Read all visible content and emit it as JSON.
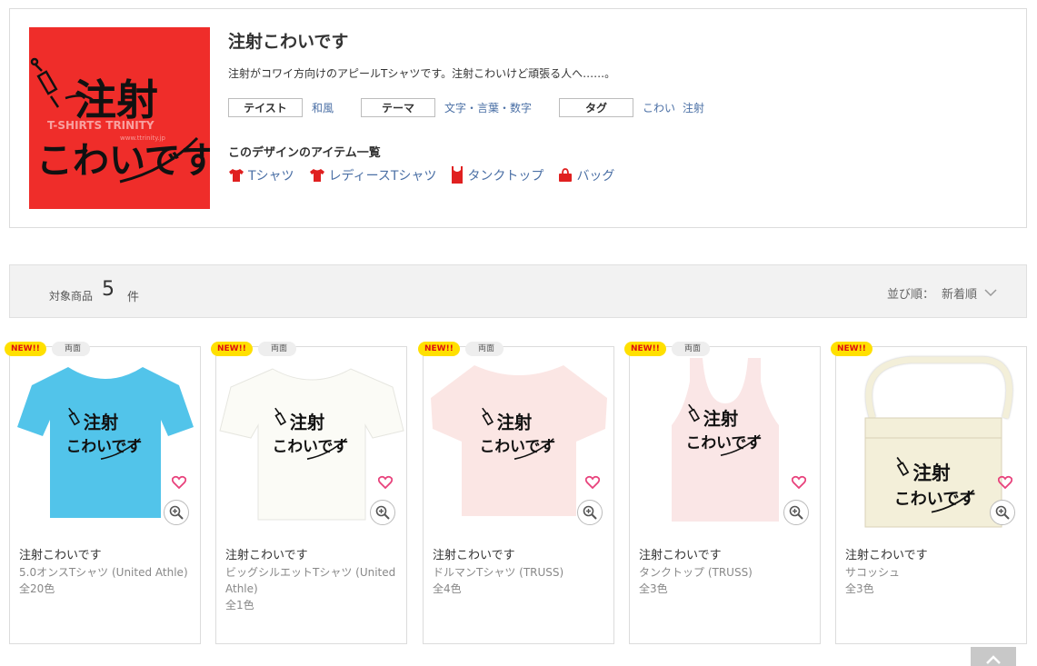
{
  "design": {
    "title": "注射こわいです",
    "description": "注射がコワイ方向けのアピールTシャツです。注射こわいけど頑張る人へ……。",
    "image_text_line1": "注射",
    "image_text_line2": "こわいです",
    "watermark": "T-SHIRTS TRINITY",
    "watermark_url": "www.ttrinity.jp",
    "image_bg_color": "#ef2d2a",
    "meta": [
      {
        "label": "テイスト",
        "links": [
          "和風"
        ]
      },
      {
        "label": "テーマ",
        "links": [
          "文字・言葉・数字"
        ]
      },
      {
        "label": "タグ",
        "links": [
          "こわい",
          "注射"
        ]
      }
    ],
    "item_list_heading": "このデザインのアイテム一覧",
    "items": [
      {
        "label": "Tシャツ",
        "icon": "tshirt-icon"
      },
      {
        "label": "レディースTシャツ",
        "icon": "ladies-tshirt-icon"
      },
      {
        "label": "タンクトップ",
        "icon": "tanktop-icon"
      },
      {
        "label": "バッグ",
        "icon": "bag-icon"
      }
    ]
  },
  "results": {
    "label": "対象商品",
    "count": "5",
    "unit": "件",
    "sort_label": "並び順：",
    "sort_value": "新着順"
  },
  "products": [
    {
      "badge_new": "NEW!!",
      "badge_side": "両面",
      "title": "注射こわいです",
      "type": "5.0オンスTシャツ (United Athle)",
      "colors": "全20色",
      "garment": "tshirt",
      "garment_color": "#52c4ea"
    },
    {
      "badge_new": "NEW!!",
      "badge_side": "両面",
      "title": "注射こわいです",
      "type": "ビッグシルエットTシャツ (United Athle)",
      "colors": "全1色",
      "garment": "bigtshirt",
      "garment_color": "#fbfbf6"
    },
    {
      "badge_new": "NEW!!",
      "badge_side": "両面",
      "title": "注射こわいです",
      "type": "ドルマンTシャツ (TRUSS)",
      "colors": "全4色",
      "garment": "dolman",
      "garment_color": "#fbe6e4"
    },
    {
      "badge_new": "NEW!!",
      "badge_side": "両面",
      "title": "注射こわいです",
      "type": "タンクトップ (TRUSS)",
      "colors": "全3色",
      "garment": "tank",
      "garment_color": "#fae6e6"
    },
    {
      "badge_new": "NEW!!",
      "badge_side": "",
      "title": "注射こわいです",
      "type": "サコッシュ",
      "colors": "全3色",
      "garment": "sacoche",
      "garment_color": "#f3efd9"
    }
  ],
  "colors": {
    "link": "#4a6fa5",
    "new_badge_bg": "#ffe000",
    "new_badge_text": "#dd1111",
    "heart": "#e8427c",
    "item_icon": "#e02020"
  }
}
